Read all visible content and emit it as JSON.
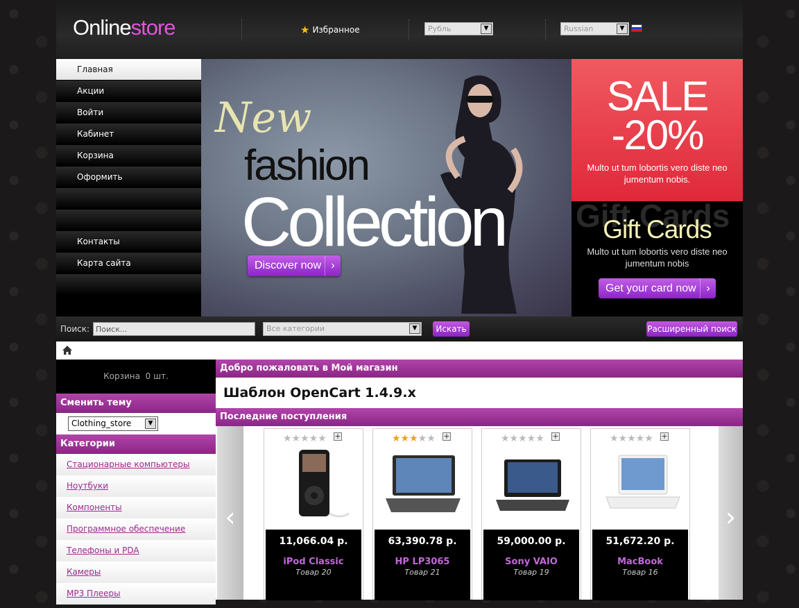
{
  "header": {
    "logo_part1": "Online",
    "logo_part2": "store",
    "favorites_label": "Избранное",
    "currency_value": "Рубль",
    "language_value": "Russian"
  },
  "menu": {
    "items": [
      "Главная",
      "Акции",
      "Войти",
      "Кабинет",
      "Корзина",
      "Оформить",
      "",
      "",
      "Контакты",
      "Карта сайта",
      ""
    ]
  },
  "banner": {
    "new": "New",
    "fashion": "fashion",
    "collection": "Collection",
    "button": "Discover now"
  },
  "promo": {
    "sale_title": "SALE",
    "sale_pct": "-20%",
    "sale_text": "Multo ut tum lobortis vero diste neo jumentum nobis.",
    "gift_ghost": "Gift Cards",
    "gift_title": "Gift Cards",
    "gift_text": "Multo ut tum lobortis vero diste neo jumentum nobis",
    "gift_button": "Get your card now"
  },
  "search": {
    "label": "Поиск:",
    "placeholder": "Поиск...",
    "category": "Все категории",
    "search_button": "Искать",
    "advanced_button": "Расширенный поиск"
  },
  "sidebar": {
    "cart_label": "Корзина",
    "cart_count": "0 шт.",
    "theme_heading": "Сменить тему",
    "theme_value": "Clothing_store",
    "categories_heading": "Категории",
    "categories": [
      "Стационарные компьютеры",
      "Ноутбуки",
      "Компоненты",
      "Программное обеспечение",
      "Телефоны и PDA",
      "Камеры",
      "MP3 Плееры"
    ]
  },
  "main": {
    "welcome_heading": "Добро пожаловать в Мой магазин",
    "welcome_text": "Шаблон OpenCart 1.4.9.x",
    "latest_heading": "Последние поступления",
    "prev_arrow": "‹",
    "next_arrow": "›",
    "products": [
      {
        "price": "11,066.04 р.",
        "name": "iPod Classic",
        "model": "Товар 20",
        "rating": 0
      },
      {
        "price": "63,390.78 р.",
        "name": "HP LP3065",
        "model": "Товар 21",
        "rating": 3
      },
      {
        "price": "59,000.00 р.",
        "name": "Sony VAIO",
        "model": "Товар 19",
        "rating": 0
      },
      {
        "price": "51,672.20 р.",
        "name": "MacBook",
        "model": "Товар 16",
        "rating": 0
      }
    ]
  },
  "colors": {
    "accent_purple": "#9a2a94",
    "brand_pink": "#e055d8",
    "sale_red": "#e0283a"
  }
}
